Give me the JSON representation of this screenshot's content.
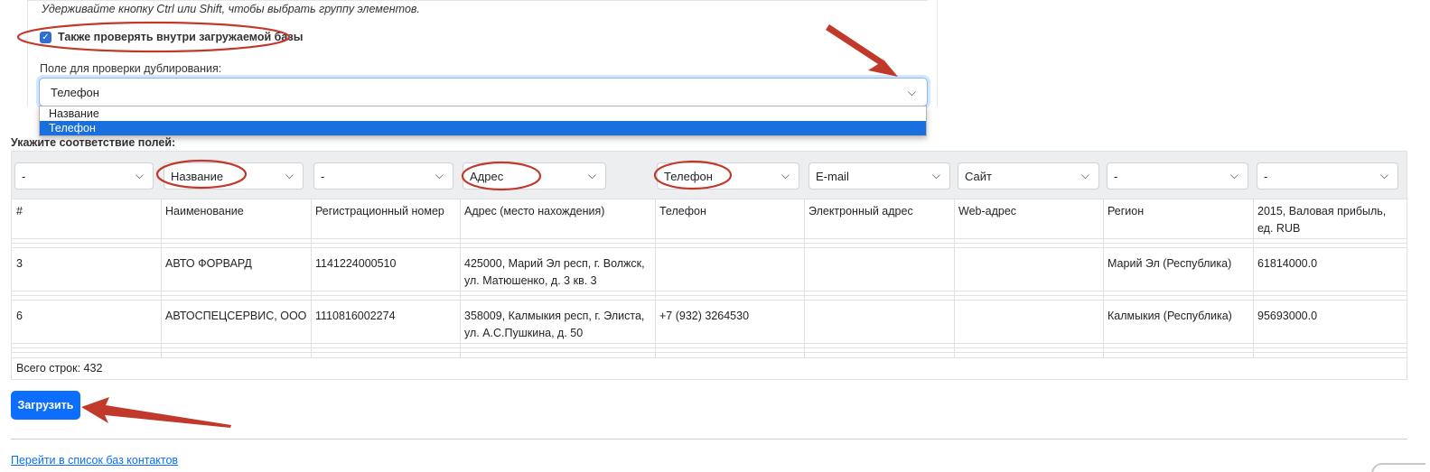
{
  "form": {
    "multi_select_hint": "Удерживайте кнопку Ctrl или Shift, чтобы выбрать группу элементов.",
    "check_inside_label": "Также проверять внутри загружаемой базы",
    "check_inside_checked": true,
    "dup_field_label": "Поле для проверки дублирования:",
    "dup_field_value": "Телефон",
    "dup_field_options": [
      "Название",
      "Телефон"
    ]
  },
  "mapping": {
    "label": "Укажите соответствие полей:",
    "selects": [
      "-",
      "Название",
      "-",
      "Адрес",
      "Телефон",
      "E-mail",
      "Сайт",
      "-",
      "-"
    ],
    "headers": [
      "#",
      "Наименование",
      "Регистрационный номер",
      "Адрес (место нахождения)",
      "Телефон",
      "Электронный адрес",
      "Web-адрес",
      "Регион",
      "2015, Валовая прибыль, ед. RUB"
    ],
    "rows": [
      [
        "3",
        "АВТО ФОРВАРД",
        "1141224000510",
        "425000, Марий Эл респ, г. Волжск, ул. Матюшенко, д. 3 кв. 3",
        "",
        "",
        "",
        "Марий Эл (Республика)",
        "61814000.0"
      ],
      [
        "6",
        "АВТОСПЕЦСЕРВИС, ООО",
        "1110816002274",
        "358009, Калмыкия респ, г. Элиста, ул. А.С.Пушкина, д. 50",
        "+7 (932) 3264530",
        "",
        "",
        "Калмыкия (Республика)",
        "95693000.0"
      ]
    ],
    "total_rows": "Всего строк: 432"
  },
  "actions": {
    "upload_label": "Загрузить",
    "contacts_link": "Перейти в список баз контактов"
  },
  "colors": {
    "primary": "#0d6efd",
    "annotation_red": "#c0392b",
    "selected_option": "#1a6fde"
  },
  "icons": {
    "checkbox": "check-icon",
    "select_arrow": "chevron-down-icon"
  }
}
